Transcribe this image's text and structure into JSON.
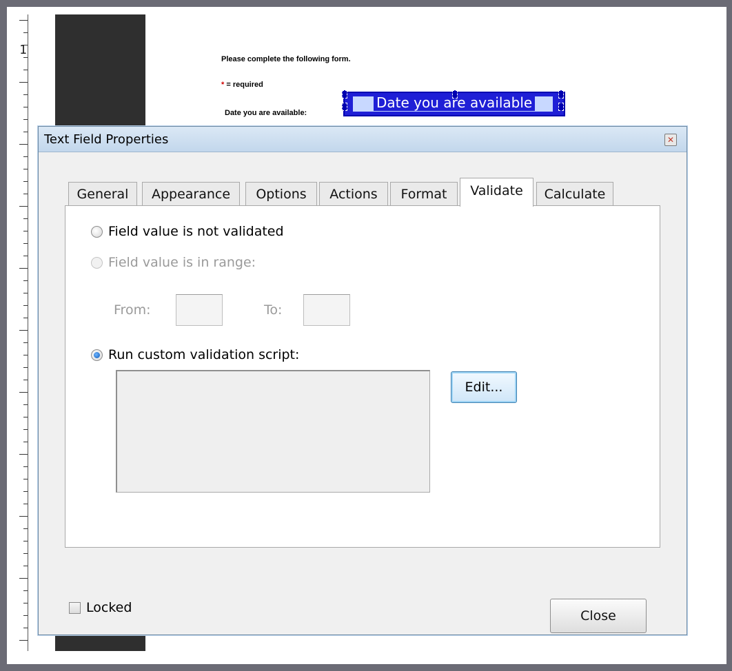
{
  "document": {
    "instruction": "Please complete the following form.",
    "required_star": "*",
    "required_note": "= required",
    "date_label": "Date you are available:",
    "field_name": "Date you are available",
    "ruler_number": "1"
  },
  "dialog": {
    "title": "Text Field Properties",
    "close_glyph": "✕",
    "tabs": [
      {
        "label": "General",
        "active": false
      },
      {
        "label": "Appearance",
        "active": false
      },
      {
        "label": "Options",
        "active": false
      },
      {
        "label": "Actions",
        "active": false
      },
      {
        "label": "Format",
        "active": false
      },
      {
        "label": "Validate",
        "active": true
      },
      {
        "label": "Calculate",
        "active": false
      }
    ],
    "validate": {
      "option_not_validated": "Field value is not validated",
      "option_in_range": "Field value is in range:",
      "from_label": "From:",
      "to_label": "To:",
      "from_value": "",
      "to_value": "",
      "option_custom_script": "Run custom validation script:",
      "selected_option": "custom_script",
      "script_text": "",
      "edit_button": "Edit..."
    },
    "locked_label": "Locked",
    "locked_checked": false,
    "close_button": "Close"
  },
  "colors": {
    "field_highlight": "#1f1fd6",
    "dialog_bg": "#f0f0f0",
    "titlebar": "#c2d7ec",
    "required_star": "#d10000"
  }
}
